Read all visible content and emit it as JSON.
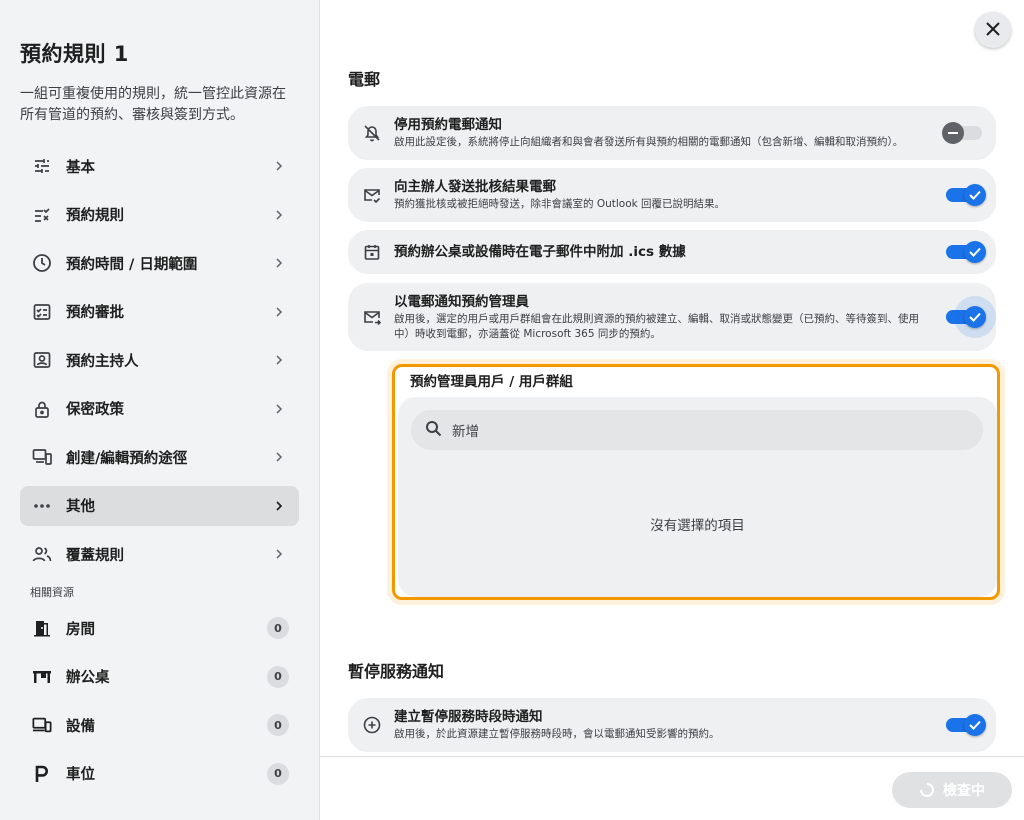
{
  "sidebar": {
    "title": "預約規則 1",
    "description": "一組可重複使用的規則，統一管控此資源在所有管道的預約、審核與簽到方式。",
    "nav": [
      {
        "label": "基本",
        "icon": "sliders-icon"
      },
      {
        "label": "預約規則",
        "icon": "checklist-icon"
      },
      {
        "label": "預約時間 / 日期範圍",
        "icon": "clock-icon"
      },
      {
        "label": "預約審批",
        "icon": "approval-icon"
      },
      {
        "label": "預約主持人",
        "icon": "host-icon"
      },
      {
        "label": "保密政策",
        "icon": "lock-icon"
      },
      {
        "label": "創建/編輯預約途徑",
        "icon": "devices-icon"
      },
      {
        "label": "其他",
        "icon": "more-horizontal-icon"
      },
      {
        "label": "覆蓋規則",
        "icon": "people-icon"
      }
    ],
    "active_index": 7,
    "resources_heading": "相關資源",
    "resources": [
      {
        "label": "房間",
        "count": "0",
        "icon": "door-icon"
      },
      {
        "label": "辦公桌",
        "count": "0",
        "icon": "desk-icon"
      },
      {
        "label": "設備",
        "count": "0",
        "icon": "device-icon"
      },
      {
        "label": "車位",
        "count": "0",
        "icon": "parking-icon"
      }
    ]
  },
  "main": {
    "email_heading": "電郵",
    "email_settings": [
      {
        "title": "停用預約電郵通知",
        "sub": "啟用此設定後，系統將停止向組織者和與會者發送所有與預約相關的電郵通知（包含新增、編輯和取消預約）。",
        "on": false,
        "icon": "bell-off-icon"
      },
      {
        "title": "向主辦人發送批核結果電郵",
        "sub": "預約獲批核或被拒絕時發送，除非會議室的 Outlook 回覆已說明結果。",
        "on": true,
        "icon": "mail-check-icon"
      },
      {
        "title": "預約辦公桌或設備時在電子郵件中附加 .ics 數據",
        "sub": "",
        "on": true,
        "icon": "calendar-icon"
      },
      {
        "title": "以電郵通知預約管理員",
        "sub": "啟用後，選定的用戶或用戶群組會在此規則資源的預約被建立、編輯、取消或狀態變更（已預約、等待簽到、使用中）時收到電郵，亦涵蓋從 Microsoft 365 同步的預約。",
        "on": true,
        "icon": "mail-arrow-icon"
      }
    ],
    "admin_box": {
      "label": "預約管理員用戶 / 用戶群組",
      "search_placeholder": "新增",
      "empty_text": "沒有選擇的項目"
    },
    "suspend_heading": "暫停服務通知",
    "suspend_setting": {
      "title": "建立暫停服務時段時通知",
      "sub": "啟用後，於此資源建立暫停服務時段時，會以電郵通知受影響的預約。",
      "on": true,
      "icon": "plus-circle-icon"
    },
    "check_button": "檢查中"
  },
  "colors": {
    "accent": "#1a73e8",
    "highlight": "#f29900"
  }
}
